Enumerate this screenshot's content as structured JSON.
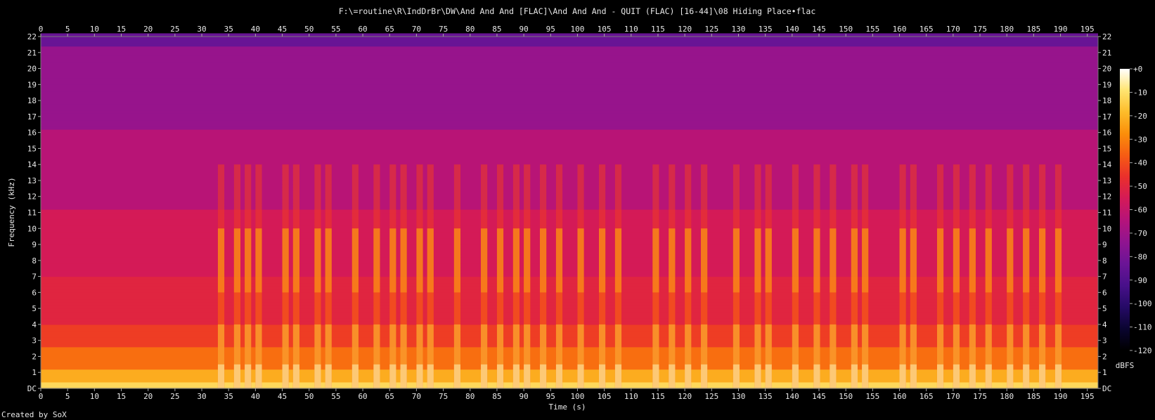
{
  "footer": "Created by SoX",
  "chart_data": {
    "type": "heatmap",
    "subtype": "spectrogram",
    "title": "F:\\=routine\\R\\IndDrBr\\DW\\And And And [FLAC]\\And And And - QUIT (FLAC) [16-44]\\08 Hiding Place•flac",
    "xlabel": "Time (s)",
    "ylabel": "Frequency (kHz)",
    "x_range": [
      0,
      197
    ],
    "y_range": [
      0,
      22
    ],
    "x_ticks": [
      "0",
      "5",
      "10",
      "15",
      "20",
      "25",
      "30",
      "35",
      "40",
      "45",
      "50",
      "55",
      "60",
      "65",
      "70",
      "75",
      "80",
      "85",
      "90",
      "95",
      "100",
      "105",
      "110",
      "115",
      "120",
      "125",
      "130",
      "135",
      "140",
      "145",
      "150",
      "155",
      "160",
      "165",
      "170",
      "175",
      "180",
      "185",
      "190",
      "195"
    ],
    "y_ticks": [
      "DC",
      "1",
      "2",
      "3",
      "4",
      "5",
      "6",
      "7",
      "8",
      "9",
      "10",
      "11",
      "12",
      "13",
      "14",
      "15",
      "16",
      "17",
      "18",
      "19",
      "20",
      "21",
      "22"
    ],
    "colorbar": {
      "label": "dBFS",
      "ticks": [
        "+0",
        "-10",
        "-20",
        "-30",
        "-40",
        "-50",
        "-60",
        "-70",
        "-80",
        "-90",
        "-100",
        "-110",
        "-120"
      ],
      "range": [
        -120,
        0
      ],
      "colors": [
        "#000000",
        "#0a0430",
        "#250a66",
        "#48108a",
        "#6b1496",
        "#901490",
        "#b5137a",
        "#d41a58",
        "#ea2f2c",
        "#f65c14",
        "#fb8e0a",
        "#fdbc2a",
        "#ffe470",
        "#ffffff"
      ]
    },
    "intensity_profile": {
      "description": "loudest near DC, decaying with frequency; bright bursts (vocals) visible up to ~10 kHz",
      "burst_times_s": [
        33,
        36,
        38,
        40,
        45,
        47,
        51,
        53,
        58,
        62,
        65,
        67,
        70,
        72,
        77,
        82,
        85,
        88,
        90,
        93,
        96,
        100,
        104,
        107,
        114,
        117,
        120,
        123,
        129,
        133,
        135,
        140,
        144,
        147,
        151,
        153,
        160,
        162,
        167,
        170,
        173,
        176,
        180,
        183,
        186,
        189
      ],
      "silence_start_s": 197
    }
  }
}
